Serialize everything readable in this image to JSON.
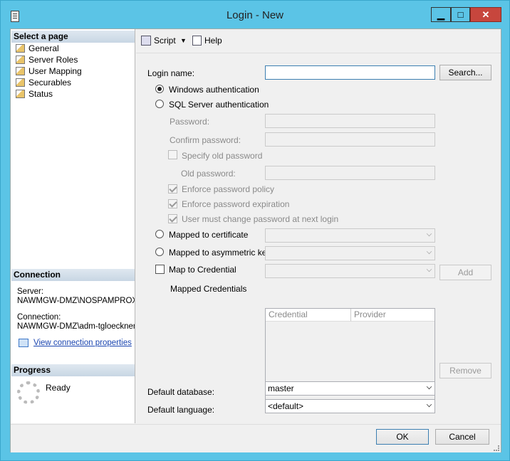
{
  "window": {
    "title": "Login - New",
    "minimize": "▁",
    "maximize": "□",
    "close": "✕"
  },
  "left": {
    "select_page_header": "Select a page",
    "pages": [
      "General",
      "Server Roles",
      "User Mapping",
      "Securables",
      "Status"
    ],
    "connection_header": "Connection",
    "server_label": "Server:",
    "server_value": "NAWMGW-DMZ\\NOSPAMPROX",
    "connection_label": "Connection:",
    "connection_value": "NAWMGW-DMZ\\adm-tgloeckner",
    "view_connection_link": "View connection properties",
    "progress_header": "Progress",
    "progress_status": "Ready"
  },
  "toolbar": {
    "script": "Script",
    "help": "Help"
  },
  "form": {
    "login_name_label": "Login name:",
    "login_name_value": "",
    "search_button": "Search...",
    "windows_auth": "Windows authentication",
    "windows_auth_selected": true,
    "sql_auth": "SQL Server authentication",
    "password_label": "Password:",
    "confirm_password_label": "Confirm password:",
    "specify_old_password": "Specify old password",
    "old_password_label": "Old password:",
    "enforce_policy": "Enforce password policy",
    "enforce_expiration": "Enforce password expiration",
    "must_change": "User must change password at next login",
    "mapped_certificate": "Mapped to certificate",
    "mapped_asym_key": "Mapped to asymmetric key",
    "map_credential": "Map to Credential",
    "add_button": "Add",
    "mapped_credentials_label": "Mapped Credentials",
    "grid_columns": [
      "Credential",
      "Provider"
    ],
    "remove_button": "Remove",
    "default_database_label": "Default database:",
    "default_database_value": "master",
    "default_language_label": "Default language:",
    "default_language_value": "<default>"
  },
  "footer": {
    "ok": "OK",
    "cancel": "Cancel"
  }
}
